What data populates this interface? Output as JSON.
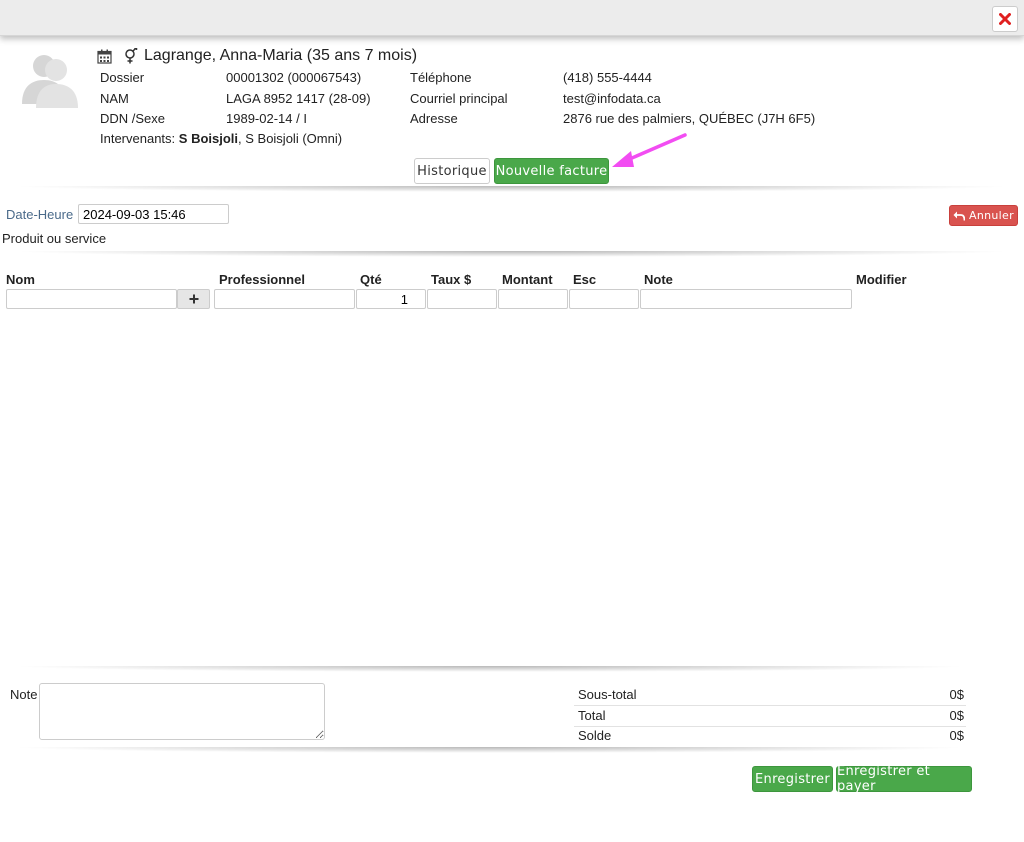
{
  "patient": {
    "name": "Lagrange, Anna-Maria (35 ans 7 mois)",
    "dossier_label": "Dossier",
    "dossier_value": "00001302 (000067543)",
    "nam_label": "NAM",
    "nam_value": "LAGA 8952 1417 (28-09)",
    "ddn_label": "DDN /Sexe",
    "ddn_value": "1989-02-14 / I",
    "telephone_label": "Téléphone",
    "telephone_value": "(418) 555-4444",
    "courriel_label": "Courriel principal",
    "courriel_value": "test@infodata.ca",
    "adresse_label": "Adresse",
    "adresse_value": "2876 rue des palmiers, QUÉBEC (J7H 6F5)",
    "intervenants_label": "Intervenants:",
    "intervenant_primary": "S Boisjoli",
    "intervenant_rest": ", S Boisjoli (Omni)"
  },
  "actions": {
    "historique": "Historique",
    "nouvelle_facture": "Nouvelle facture"
  },
  "invoice": {
    "datetime_label": "Date-Heure",
    "datetime_value": "2024-09-03 15:46",
    "annuler": "Annuler",
    "section_title": "Produit ou service",
    "columns": [
      "Nom",
      "Professionnel",
      "Qté",
      "Taux $",
      "Montant",
      "Esc",
      "Note",
      "Modifier"
    ],
    "row": {
      "nom": "",
      "professionnel": "",
      "qte": "1",
      "taux": "",
      "montant": "",
      "esc": "",
      "note": ""
    }
  },
  "footer": {
    "note_label": "Note",
    "soustotal_label": "Sous-total",
    "soustotal_value": "0$",
    "total_label": "Total",
    "total_value": "0$",
    "solde_label": "Solde",
    "solde_value": "0$",
    "enregistrer": "Enregistrer",
    "enregistrer_payer": "Enregistrer et payer"
  },
  "icons": {
    "close": "close-icon",
    "avatar": "avatar-icon",
    "calendar": "calendar-icon",
    "gender": "gender-icon",
    "plus": "plus-icon",
    "undo": "undo-icon",
    "annotation_arrow": "arrow-icon"
  },
  "colors": {
    "success": "#4aa84a",
    "danger": "#d9534f",
    "close_x": "#e02020",
    "annotation_arrow": "#f24df2",
    "label_blue": "#4a6a8a"
  }
}
